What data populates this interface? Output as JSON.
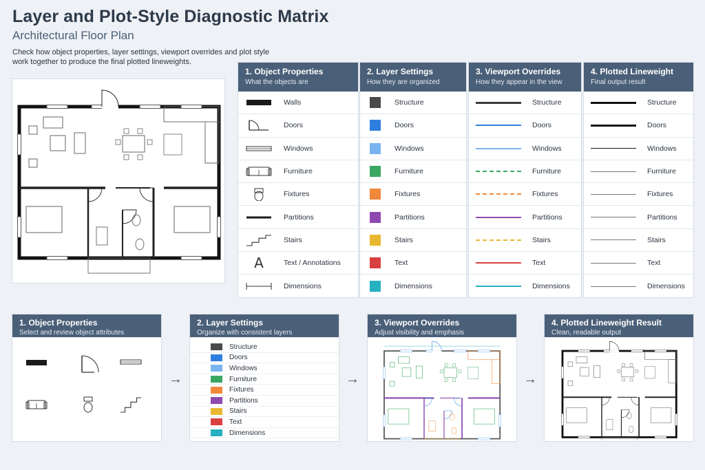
{
  "header": {
    "title": "Layer and Plot-Style Diagnostic Matrix",
    "subtitle": "Architectural Floor Plan",
    "intro": "Check how object properties, layer settings, viewport overrides and plot style work together to produce the final plotted lineweights."
  },
  "matrix": {
    "columns": [
      {
        "title": "1. Object Properties",
        "sub": "What the objects are"
      },
      {
        "title": "2. Layer Settings",
        "sub": "How they are organized"
      },
      {
        "title": "3. Viewport Overrides",
        "sub": "How they appear in the view"
      },
      {
        "title": "4. Plotted Lineweight",
        "sub": "Final output result"
      }
    ],
    "object_labels": [
      "Walls",
      "Doors",
      "Windows",
      "Furniture",
      "Fixtures",
      "Partitions",
      "Stairs",
      "Text / Annotations",
      "Dimensions"
    ],
    "object_icons": [
      "wall-icon",
      "door-icon",
      "window-icon",
      "sofa-icon",
      "toilet-icon",
      "partition-icon",
      "stairs-icon",
      "text-icon",
      "dimension-icon"
    ],
    "layers": [
      {
        "name": "Structure",
        "color": "#4a4a4a"
      },
      {
        "name": "Doors",
        "color": "#2f7fe0"
      },
      {
        "name": "Windows",
        "color": "#7ab4f0"
      },
      {
        "name": "Furniture",
        "color": "#3aa862"
      },
      {
        "name": "Fixtures",
        "color": "#f0883a"
      },
      {
        "name": "Partitions",
        "color": "#8e48b0"
      },
      {
        "name": "Stairs",
        "color": "#e8b830"
      },
      {
        "name": "Text",
        "color": "#d94040"
      },
      {
        "name": "Dimensions",
        "color": "#26b0c0"
      }
    ],
    "viewport_styles": [
      "solid",
      "solid",
      "solid",
      "dashed",
      "dashed",
      "solid",
      "dashed",
      "solid",
      "solid"
    ],
    "plot_weights": [
      3.5,
      3,
      1.6,
      1,
      0.8,
      1.4,
      0.8,
      1,
      0.8
    ]
  },
  "panels": [
    {
      "title": "1. Object Properties",
      "sub": "Select and review object attributes"
    },
    {
      "title": "2. Layer Settings",
      "sub": "Organize with consistent layers"
    },
    {
      "title": "3. Viewport Overrides",
      "sub": "Adjust visibility and emphasis"
    },
    {
      "title": "4. Plotted Lineweight Result",
      "sub": "Clean, readable output"
    }
  ],
  "panel1_icons": [
    "wall-icon",
    "door-icon",
    "window-icon",
    "sofa-icon",
    "toilet-icon",
    "stairs-icon"
  ]
}
